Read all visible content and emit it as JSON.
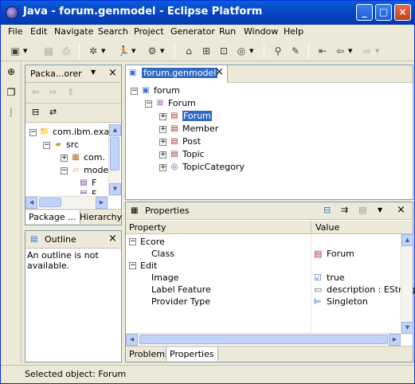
{
  "window": {
    "title": "Java - forum.genmodel - Eclipse Platform"
  },
  "menu": [
    "File",
    "Edit",
    "Navigate",
    "Search",
    "Project",
    "Generator",
    "Run",
    "Window",
    "Help"
  ],
  "package_explorer": {
    "title": "Packa...orer",
    "tree": [
      "com.ibm.exa",
      "src",
      "com.",
      "mode",
      "F",
      "F"
    ],
    "tabs": [
      "Package ...",
      "Hierarchy"
    ]
  },
  "outline": {
    "title": "Outline",
    "message": "An outline is not available."
  },
  "editor": {
    "tab": "forum.genmodel",
    "tree": [
      "forum",
      "Forum",
      "Forum",
      "Member",
      "Post",
      "Topic",
      "TopicCategory"
    ]
  },
  "properties": {
    "title": "Properties",
    "headers": [
      "Property",
      "Value"
    ],
    "rows": [
      {
        "property": "Ecore",
        "value": "",
        "category": true
      },
      {
        "property": "Class",
        "value": "Forum",
        "category": false
      },
      {
        "property": "Edit",
        "value": "",
        "category": true
      },
      {
        "property": "Image",
        "value": "true",
        "category": false
      },
      {
        "property": "Label Feature",
        "value": "description : EString",
        "category": false
      },
      {
        "property": "Provider Type",
        "value": "Singleton",
        "category": false
      }
    ],
    "tabs": [
      "Problems",
      "Properties"
    ]
  },
  "status": {
    "text": "Selected object: Forum"
  }
}
